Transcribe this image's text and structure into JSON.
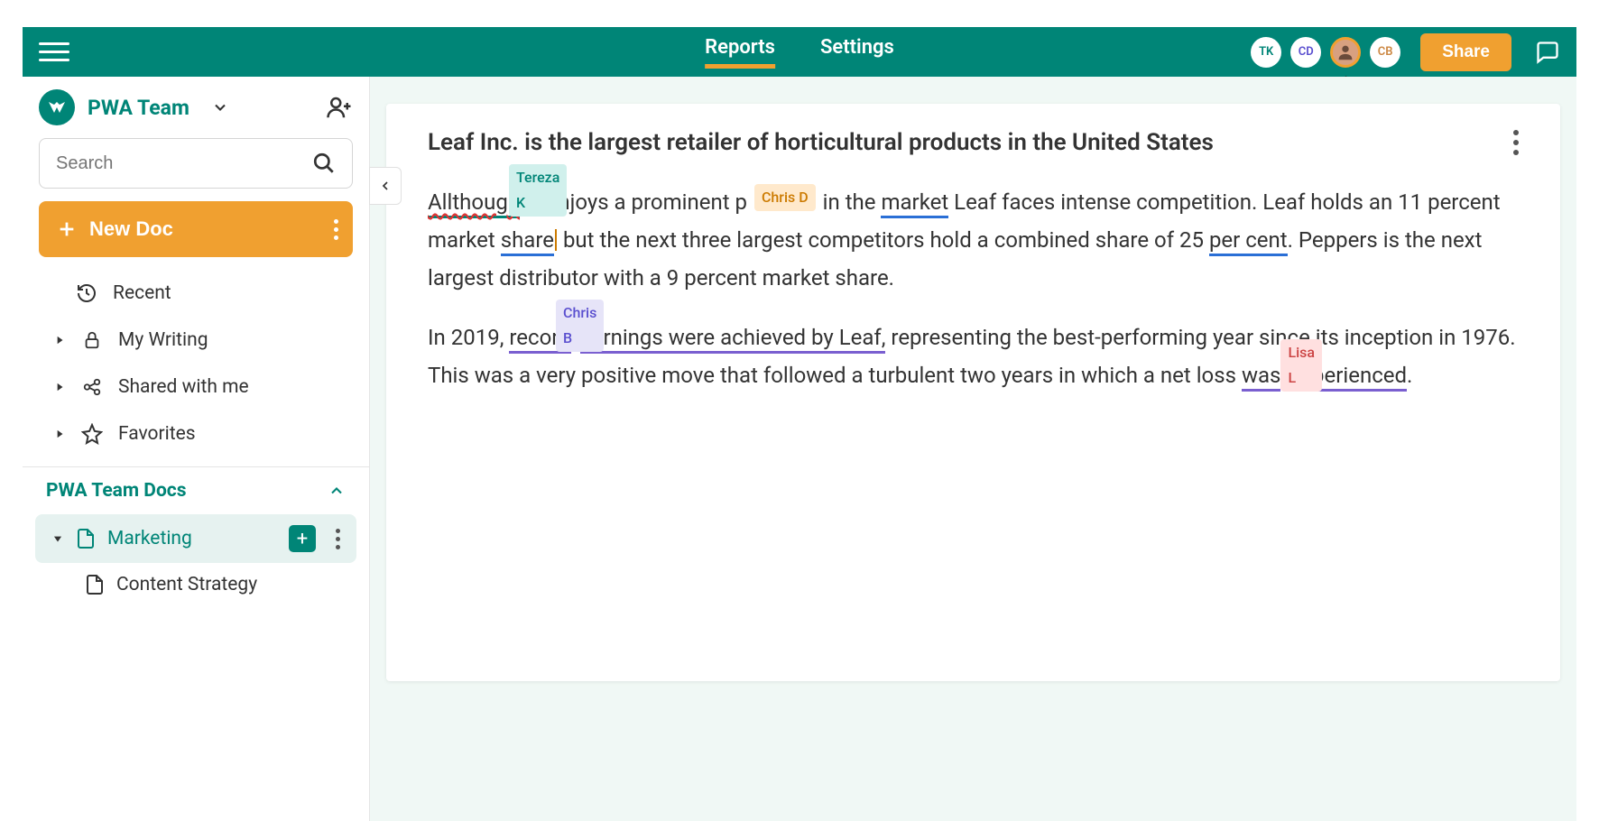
{
  "topbar": {
    "tabs": {
      "reports": "Reports",
      "settings": "Settings"
    },
    "avatars": {
      "tk": "TK",
      "cd": "CD",
      "cb": "CB"
    },
    "tooltip": "Lisa L",
    "share": "Share"
  },
  "sidebar": {
    "team": "PWA Team",
    "search_placeholder": "Search",
    "new_doc": "New Doc",
    "nav": {
      "recent": "Recent",
      "my_writing": "My Writing",
      "shared": "Shared with me",
      "favorites": "Favorites"
    },
    "section": "PWA Team Docs",
    "folders": {
      "marketing": "Marketing",
      "content_strategy": "Content Strategy"
    }
  },
  "document": {
    "title": "Leaf Inc. is the largest retailer of horticultural products in the United States",
    "labels": {
      "tereza": "Tereza K",
      "chrisd": "Chris D",
      "chrisb": "Chris B",
      "lisa": "Lisa L"
    },
    "p1": {
      "w_allthough": "Allthough",
      "t1": " it enjoys a prominent p",
      "t2": " in the ",
      "w_market": "market",
      "t3": " Leaf faces intense competition. Leaf holds an 11 percent market ",
      "w_share": "share",
      "t4": " but the next three largest competitors hold a combined share of 25 ",
      "w_percent": "per cent",
      "t5": ". Peppers is the next largest distributor with a 9 percent market share."
    },
    "p2": {
      "t1": "In 2019, ",
      "w_record": "record",
      "t2": " ",
      "w_earnings": "earnings were achieved by Leaf,",
      "t3": " representing the best-performing year since its inception in 1976. This was a very positive move that followed a turbulent two years in which a net loss ",
      "w_was": "was",
      "t4": " ",
      "w_exp": "experienced",
      "t5": "."
    }
  }
}
